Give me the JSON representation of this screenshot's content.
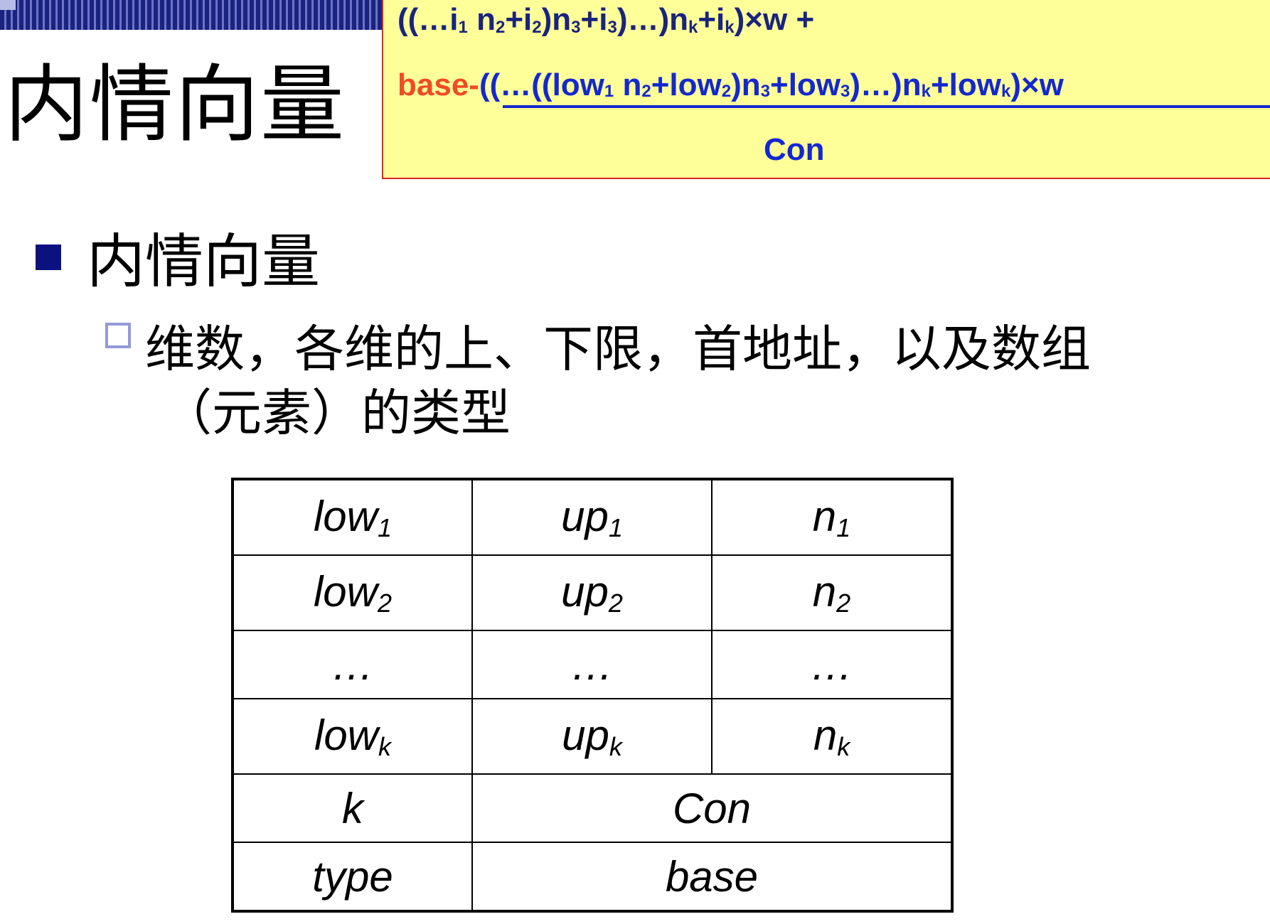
{
  "slide": {
    "title": "内情向量",
    "bullet1": "内情向量",
    "bullet2_line1": "维数，各维的上、下限，首地址，以及数组",
    "bullet2_line2": "（元素）的类型"
  },
  "formula": {
    "line1_parts": [
      "((…i",
      "1",
      " n",
      "2",
      "+i",
      "2",
      ")n",
      "3",
      "+i",
      "3",
      ")…)n",
      "k",
      "+i",
      "k",
      ")×w +"
    ],
    "base_label": "base-",
    "numerator_parts": [
      "((…((low",
      "1",
      " n",
      "2",
      "+low",
      "2",
      ")n",
      "3",
      "+low",
      "3",
      ")…)n",
      "k",
      "+low",
      "k",
      ")×w"
    ],
    "denominator": "Con"
  },
  "table": {
    "rows": [
      {
        "c1": "low",
        "c1s": "1",
        "c2": "up",
        "c2s": "1",
        "c3": "n",
        "c3s": "1"
      },
      {
        "c1": "low",
        "c1s": "2",
        "c2": "up",
        "c2s": "2",
        "c3": "n",
        "c3s": "2"
      },
      {
        "c1": "…",
        "c2": "…",
        "c3": "…"
      },
      {
        "c1": "low",
        "c1s": "k",
        "c2": "up",
        "c2s": "k",
        "c3": "n",
        "c3s": "k"
      }
    ],
    "k_label": "k",
    "con_label": "Con",
    "type_label": "type",
    "base_label": "base"
  }
}
